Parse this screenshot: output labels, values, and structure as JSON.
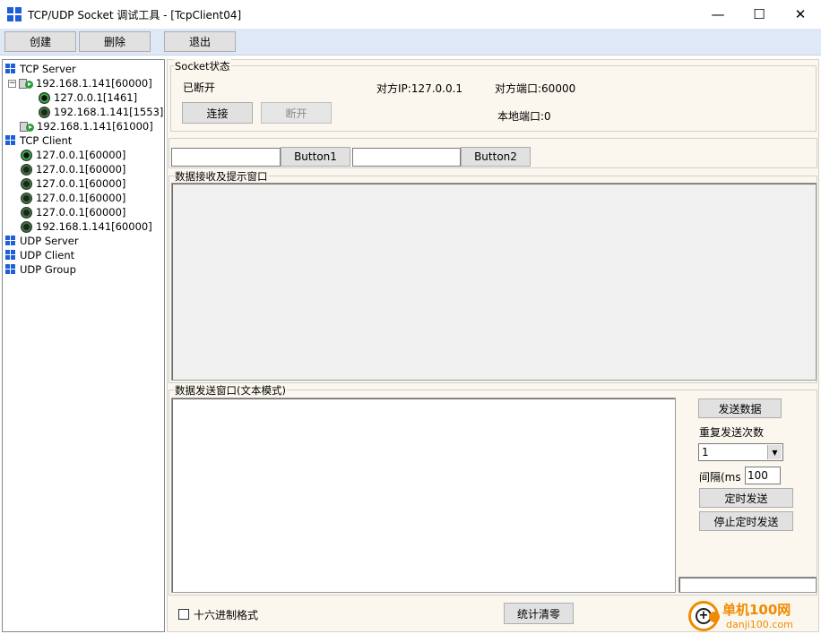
{
  "window": {
    "title": "TCP/UDP Socket 调试工具 - [TcpClient04]",
    "minimize_symbol": "—",
    "maximize_symbol": "☐",
    "close_symbol": "✕"
  },
  "toolbar": {
    "create_label": "创建",
    "delete_label": "删除",
    "exit_label": "退出"
  },
  "tree": {
    "tcp_server": "TCP Server",
    "server_1": "192.168.1.141[60000]",
    "server_1_child_1": "127.0.0.1[1461]",
    "server_1_child_2": "192.168.1.141[1553]",
    "server_2": "192.168.1.141[61000]",
    "tcp_client": "TCP Client",
    "clients": [
      "127.0.0.1[60000]",
      "127.0.0.1[60000]",
      "127.0.0.1[60000]",
      "127.0.0.1[60000]",
      "127.0.0.1[60000]",
      "192.168.1.141[60000]"
    ],
    "udp_server": "UDP Server",
    "udp_client": "UDP Client",
    "udp_group": "UDP Group"
  },
  "socket_status": {
    "legend": "Socket状态",
    "state": "已断开",
    "remote_ip": "对方IP:127.0.0.1",
    "remote_port": "对方端口:60000",
    "local_port": "本地端口:0",
    "connect_label": "连接",
    "disconnect_label": "断开"
  },
  "inputs_row": {
    "field1_value": "",
    "button1_label": "Button1",
    "field2_value": "",
    "button2_label": "Button2"
  },
  "receive": {
    "legend": "数据接收及提示窗口"
  },
  "send": {
    "legend": "数据发送窗口(文本模式)",
    "send_label": "发送数据",
    "repeat_label": "重复发送次数",
    "repeat_value": "1",
    "interval_label": "间隔(ms",
    "interval_value": "100",
    "timer_send_label": "定时发送",
    "stop_timer_label": "停止定时发送"
  },
  "footer": {
    "hex_label": "十六进制格式",
    "reset_stats_label": "统计清零"
  },
  "watermark": {
    "brand": "单机100网",
    "url": "danji100.com"
  },
  "colors": {
    "accent_blue": "#1e5fd8",
    "toolbar_bg": "#dfe8f7",
    "pane_bg": "#fbf7ee",
    "watermark_orange": "#f08a00"
  }
}
